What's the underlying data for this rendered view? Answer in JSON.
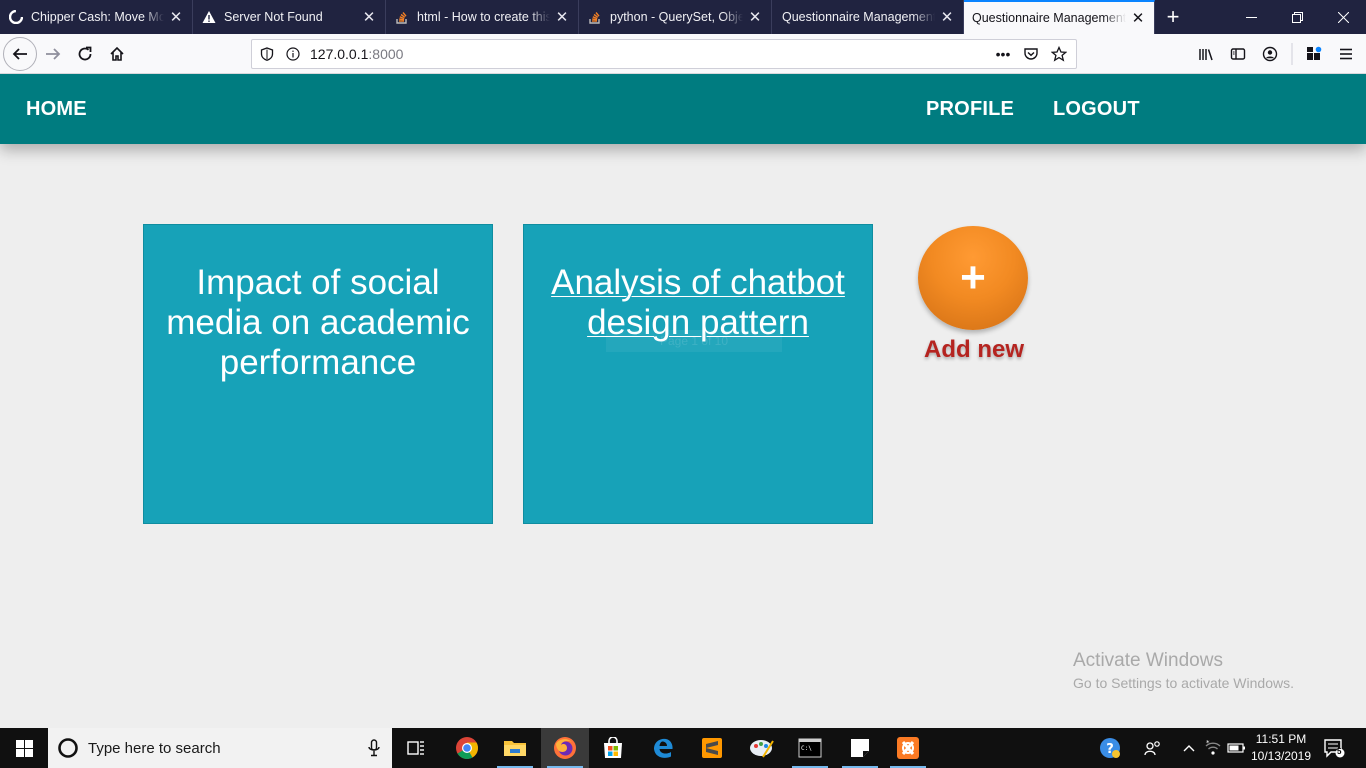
{
  "browser": {
    "tabs": [
      {
        "title": "Chipper Cash: Move Mon",
        "icon": "chipper-favicon",
        "close": "✕"
      },
      {
        "title": "Server Not Found",
        "icon": "warning-icon",
        "close": "✕"
      },
      {
        "title": "html - How to create this",
        "icon": "stackoverflow-icon",
        "close": "✕"
      },
      {
        "title": "python - QuerySet, Object",
        "icon": "stackoverflow-icon",
        "close": "✕"
      },
      {
        "title": "Questionnaire Management S",
        "icon": "",
        "close": "✕"
      },
      {
        "title": "Questionnaire Management S",
        "icon": "",
        "close": "✕",
        "active": true
      }
    ],
    "new_tab": "+",
    "url_host": "127.0.0.1",
    "url_port": ":8000",
    "page_actions": "•••",
    "accent": "#0a84ff"
  },
  "site": {
    "nav": {
      "home": "HOME",
      "profile": "PROFILE",
      "logout": "LOGOUT"
    },
    "header_color": "#007c80",
    "cards": [
      {
        "title": "Impact of social media on academic performance"
      },
      {
        "title": "Analysis of chatbot design pattern",
        "ghost_text": "Page 1 of 10"
      }
    ],
    "card_color": "#17a2b8",
    "add_new": {
      "symbol": "+",
      "label": "Add new",
      "color": "#f28a22",
      "label_color": "#b52420"
    }
  },
  "watermark": {
    "line1": "Activate Windows",
    "line2": "Go to Settings to activate Windows."
  },
  "taskbar": {
    "search_placeholder": "Type here to search",
    "time": "11:51 PM",
    "date": "10/13/2019",
    "notifications": "5",
    "apps": [
      "task-view-icon",
      "chrome-icon",
      "file-explorer-icon",
      "firefox-icon",
      "store-icon",
      "edge-icon",
      "sublime-icon",
      "paint-icon",
      "cmd-icon",
      "sticky-notes-icon",
      "xampp-icon"
    ]
  }
}
